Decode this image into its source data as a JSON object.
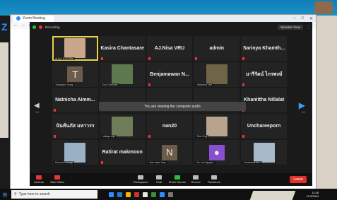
{
  "browser": {
    "tab_title": "Zoom Meeting",
    "profile_label": "Paused"
  },
  "meeting": {
    "recording_label": "Recording",
    "view_label": "Speaker View",
    "share_tip": "You are viewing the computer audio",
    "page_left": "1/4",
    "page_right": "1/4",
    "tiles": [
      {
        "name": "",
        "caption": "Aj.Nui TUOI Nifa",
        "kind": "photo",
        "color": "#c9a68c",
        "active": true
      },
      {
        "name": "Kasira Chantasare",
        "caption": "",
        "kind": "name"
      },
      {
        "name": "AJ.Nisa VRU",
        "caption": "",
        "kind": "name"
      },
      {
        "name": "admin",
        "caption": "",
        "kind": "name"
      },
      {
        "name": "Sarinya  Khamth...",
        "caption": "",
        "kind": "name"
      },
      {
        "name": "T",
        "caption": "Tosompho Sung",
        "kind": "initial"
      },
      {
        "name": "",
        "caption": "Kun Chiimuen",
        "kind": "photo",
        "color": "#5d7a4e"
      },
      {
        "name": "Benjamawan  N...",
        "caption": "",
        "kind": "name"
      },
      {
        "name": "",
        "caption": "Yotherina Usit",
        "kind": "photo",
        "color": "#6f6446"
      },
      {
        "name": "นารีรัตน์ ไกรพงษ์",
        "caption": "",
        "kind": "name"
      },
      {
        "name": "Natnicha  Aimm...",
        "caption": "",
        "kind": "name"
      },
      {
        "name": "",
        "caption": "",
        "kind": "share"
      },
      {
        "name": "",
        "caption": "",
        "kind": "share"
      },
      {
        "name": "",
        "caption": "",
        "kind": "share"
      },
      {
        "name": "Khanittha Nillalat",
        "caption": "",
        "kind": "name"
      },
      {
        "name": "นันท์นภัส มหาวรร",
        "caption": "",
        "kind": "name"
      },
      {
        "name": "",
        "caption": "nattaya wip",
        "kind": "photo",
        "color": "#6f7d59"
      },
      {
        "name": "nan20",
        "caption": "",
        "kind": "name"
      },
      {
        "name": "",
        "caption": "Siriz Ong",
        "kind": "photo",
        "color": "#b7a38e"
      },
      {
        "name": "Unchareeporn",
        "caption": "",
        "kind": "name"
      },
      {
        "name": "",
        "caption": "Khumuki Sangki",
        "kind": "photo",
        "color": "#9ab0c4"
      },
      {
        "name": "Ratirat makmoon",
        "caption": "",
        "kind": "name"
      },
      {
        "name": "N",
        "caption": "Nan kwan thay",
        "kind": "initial"
      },
      {
        "name": "",
        "caption": "Bo Lan Nguyen",
        "kind": "avatar-purple"
      },
      {
        "name": "",
        "caption": "Kanchana Im...",
        "kind": "photo",
        "color": "#a7b9c9"
      }
    ],
    "toolbar": {
      "unmute": "Unmute",
      "start_video": "Start Video",
      "participants": "Participants",
      "chat": "Chat",
      "share_screen": "Share Screen",
      "record": "Record",
      "reactions": "Reactions",
      "leave": "Leave"
    }
  },
  "taskbar": {
    "search_placeholder": "Type here to search",
    "time": "11:48",
    "date": "11/3/2564"
  }
}
